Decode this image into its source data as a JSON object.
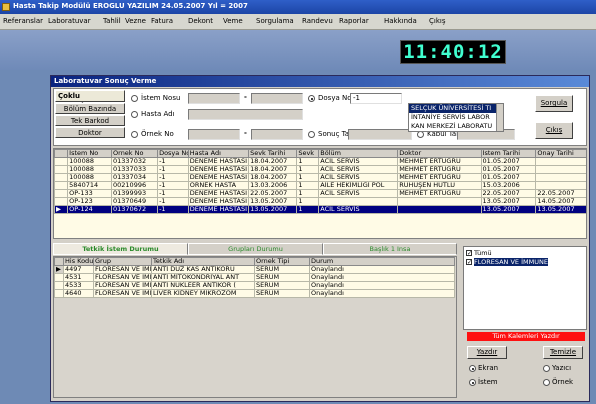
{
  "app": {
    "title": "Hasta Takip Modülü     EROĞLU YAZILIM     24.05.2007     Yıl = 2007",
    "clock": "11:40:12"
  },
  "menu": [
    "Referanslar",
    "Laboratuvar",
    "Tahlil",
    "Vezne",
    "Fatura",
    "Dekont",
    "Veme",
    "Sorgulama",
    "Randevu",
    "Raporlar",
    "Hakkında",
    "Çıkış"
  ],
  "window": {
    "title": "Laboratuvar Sonuç Verme"
  },
  "form": {
    "side_buttons": [
      "Çoklu Sorgulama",
      "Bölüm Bazında",
      "Tek Barkod",
      "Doktor"
    ],
    "istem_nosu_label": "İstem Nosu",
    "hasta_adi_label": "Hasta Adı",
    "ornek_no_label": "Örnek No",
    "dash": "-",
    "dosya_no_label": "Dosya No",
    "dosya_no_value": "-1",
    "sonuc_tar_label": "Sonuç Tar",
    "kabul_tar_label": "Kabul Tar",
    "listbox": [
      "SELÇUK ÜNİVERSİTESİ TI",
      "İNTANİYE SERVİS LABOR",
      "KAN MERKEZİ LABORATU"
    ],
    "sorgula": "Sorgula",
    "cikis": "Çıkış"
  },
  "grid1": {
    "columns": [
      "İstem No",
      "Örnek No",
      "Dosya No",
      "Hasta Adı",
      "Sevk Tarihi",
      "Sevk",
      "Bölüm",
      "Doktor",
      "İstem Tarihi",
      "Onay Tarihi"
    ],
    "rows": [
      [
        "100088",
        "01337032",
        "-1",
        "DENEME HASTASI",
        "18.04.2007",
        "1",
        "ACİL SERVİS",
        "MEHMET ERTUĞRU",
        "01.05.2007",
        ""
      ],
      [
        "100088",
        "01337033",
        "-1",
        "DENEME HASTASI",
        "18.04.2007",
        "1",
        "ACİL SERVİS",
        "MEHMET ERTUĞRU",
        "01.05.2007",
        ""
      ],
      [
        "100088",
        "01337034",
        "-1",
        "DENEME HASTASI",
        "18.04.2007",
        "1",
        "ACİL SERVİS",
        "MEHMET ERTUĞRU",
        "01.05.2007",
        ""
      ],
      [
        "5840714",
        "00210996",
        "-1",
        "ÖRNEK HASTA",
        "13.03.2006",
        "1",
        "AİLE HEKİMLİĞİ POL",
        "RUHUŞEN HUTLU",
        "15.03.2006",
        ""
      ],
      [
        "OP-133",
        "01399993",
        "-1",
        "DENEME HASTASI",
        "22.05.2007",
        "1",
        "ACİL SERVİS",
        "MEHMET ERTUĞRU",
        "22.05.2007",
        "22.05.2007"
      ],
      [
        "OP-123",
        "01370649",
        "-1",
        "DENEME HASTASI",
        "13.05.2007",
        "1",
        "",
        "",
        "13.05.2007",
        "14.05.2007"
      ],
      [
        "OP-124",
        "01370672",
        "-1",
        "DENEME HASTASI",
        "13.05.2007",
        "1",
        "ACİL SERVİS",
        "",
        "13.05.2007",
        "13.05.2007"
      ]
    ]
  },
  "tabs": [
    "Tetkik İstem Durumu",
    "Grupları Durumu",
    "Başlık 1 Insa"
  ],
  "grid2": {
    "columns": [
      "His Kodu",
      "Grup",
      "Tetkik Adı",
      "Örnek Tipi",
      "Durum"
    ],
    "rows": [
      [
        "4497",
        "FLORESAN VE İMM",
        "ANTİ DUZ KAS ANTİKORU",
        "SERUM",
        "Onaylandı"
      ],
      [
        "4531",
        "FLORESAN VE İMM",
        "ANTİ MİTOKONDRİYAL ANT",
        "SERUM",
        "Onaylandı"
      ],
      [
        "4533",
        "FLORESAN VE İMM",
        "ANTİ NÜKLEER ANTİKOR (",
        "SERUM",
        "Onaylandı"
      ],
      [
        "4640",
        "FLORESAN VE İMM",
        "LİVER KİDNEY MİKROZOM",
        "SERUM",
        "Onaylandı"
      ]
    ]
  },
  "right": {
    "checklist": [
      "Tümü",
      "FLORESAN VE İMMUNE"
    ],
    "red_bar": "Tüm Kalemleri Yazdır",
    "yazdir": "Yazdır",
    "temizle": "Temizle",
    "ekran": "Ekran",
    "yazici": "Yazıcı",
    "istem": "İstem",
    "ornek": "Örnek"
  }
}
